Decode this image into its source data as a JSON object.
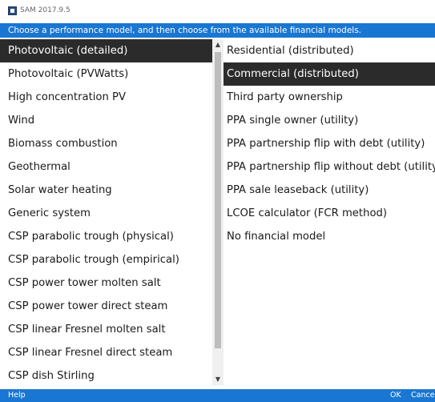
{
  "window": {
    "title": "SAM 2017.9.5"
  },
  "header": {
    "instruction": "Choose a performance model, and then choose from the available financial models."
  },
  "performance_models": [
    {
      "label": "Photovoltaic (detailed)",
      "selected": true
    },
    {
      "label": "Photovoltaic (PVWatts)"
    },
    {
      "label": "High concentration PV"
    },
    {
      "label": "Wind"
    },
    {
      "label": "Biomass combustion"
    },
    {
      "label": "Geothermal"
    },
    {
      "label": "Solar water heating"
    },
    {
      "label": "Generic system"
    },
    {
      "label": "CSP parabolic trough (physical)"
    },
    {
      "label": "CSP parabolic trough (empirical)"
    },
    {
      "label": "CSP power tower molten salt"
    },
    {
      "label": "CSP power tower direct steam"
    },
    {
      "label": "CSP linear Fresnel molten salt"
    },
    {
      "label": "CSP linear Fresnel direct steam"
    },
    {
      "label": "CSP dish Stirling"
    }
  ],
  "financial_models": [
    {
      "label": "Residential (distributed)"
    },
    {
      "label": "Commercial (distributed)",
      "selected": true
    },
    {
      "label": "Third party ownership"
    },
    {
      "label": "PPA single owner (utility)"
    },
    {
      "label": "PPA partnership flip with debt (utility)"
    },
    {
      "label": "PPA partnership flip without debt (utility)"
    },
    {
      "label": "PPA sale leaseback (utility)"
    },
    {
      "label": "LCOE calculator (FCR method)"
    },
    {
      "label": "No financial model"
    }
  ],
  "footer": {
    "help_label": "Help",
    "ok_label": "OK",
    "cancel_label": "Cancel"
  },
  "icons": {
    "app": "sam-app-icon",
    "scroll_up": "chevron-up-icon",
    "scroll_down": "chevron-down-icon"
  },
  "colors": {
    "accent": "#1976d2",
    "selected_bg": "#2b2b2b"
  }
}
